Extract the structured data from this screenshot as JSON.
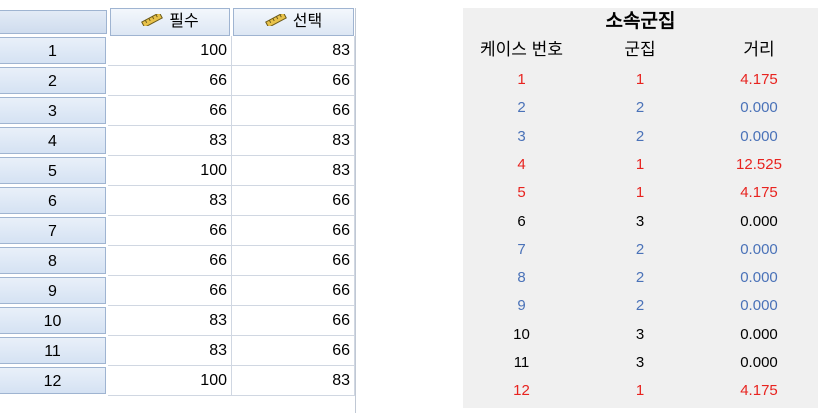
{
  "editor": {
    "columns": [
      {
        "name": "필수",
        "icon": "ruler-icon"
      },
      {
        "name": "선택",
        "icon": "ruler-icon"
      }
    ],
    "rows": [
      {
        "num": "1",
        "v1": "100",
        "v2": "83"
      },
      {
        "num": "2",
        "v1": "66",
        "v2": "66"
      },
      {
        "num": "3",
        "v1": "66",
        "v2": "66"
      },
      {
        "num": "4",
        "v1": "83",
        "v2": "83"
      },
      {
        "num": "5",
        "v1": "100",
        "v2": "83"
      },
      {
        "num": "6",
        "v1": "83",
        "v2": "66"
      },
      {
        "num": "7",
        "v1": "66",
        "v2": "66"
      },
      {
        "num": "8",
        "v1": "66",
        "v2": "66"
      },
      {
        "num": "9",
        "v1": "66",
        "v2": "66"
      },
      {
        "num": "10",
        "v1": "83",
        "v2": "66"
      },
      {
        "num": "11",
        "v1": "83",
        "v2": "66"
      },
      {
        "num": "12",
        "v1": "100",
        "v2": "83"
      }
    ]
  },
  "membership": {
    "title": "소속군집",
    "headers": [
      "케이스 번호",
      "군집",
      "거리"
    ],
    "colors": {
      "1": "#e8231f",
      "2": "#4a72b8",
      "3": "#000000"
    },
    "rows": [
      {
        "case": "1",
        "cluster": "1",
        "distance": "4.175"
      },
      {
        "case": "2",
        "cluster": "2",
        "distance": "0.000"
      },
      {
        "case": "3",
        "cluster": "2",
        "distance": "0.000"
      },
      {
        "case": "4",
        "cluster": "1",
        "distance": "12.525"
      },
      {
        "case": "5",
        "cluster": "1",
        "distance": "4.175"
      },
      {
        "case": "6",
        "cluster": "3",
        "distance": "0.000"
      },
      {
        "case": "7",
        "cluster": "2",
        "distance": "0.000"
      },
      {
        "case": "8",
        "cluster": "2",
        "distance": "0.000"
      },
      {
        "case": "9",
        "cluster": "2",
        "distance": "0.000"
      },
      {
        "case": "10",
        "cluster": "3",
        "distance": "0.000"
      },
      {
        "case": "11",
        "cluster": "3",
        "distance": "0.000"
      },
      {
        "case": "12",
        "cluster": "1",
        "distance": "4.175"
      }
    ]
  }
}
